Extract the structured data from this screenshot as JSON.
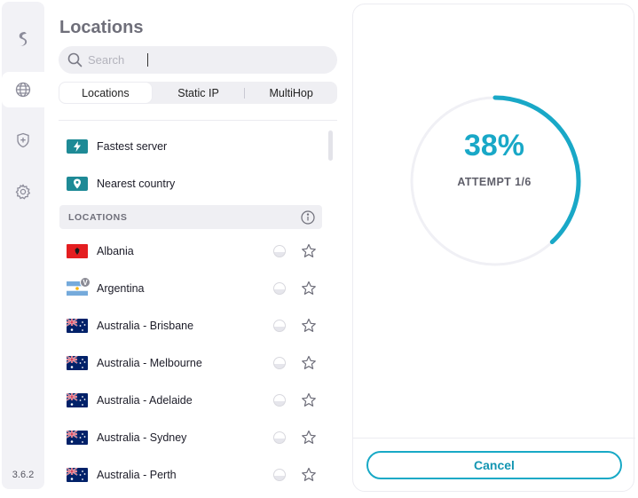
{
  "app": {
    "version": "3.6.2"
  },
  "nav": {
    "items": [
      {
        "icon": "surfshark-logo-icon"
      },
      {
        "icon": "globe-icon",
        "active": true
      },
      {
        "icon": "shield-plus-icon"
      },
      {
        "icon": "gear-icon"
      }
    ]
  },
  "locations_panel": {
    "title": "Locations",
    "search": {
      "placeholder": "Search",
      "value": ""
    },
    "tabs": [
      {
        "label": "Locations",
        "active": true
      },
      {
        "label": "Static IP",
        "active": false
      },
      {
        "label": "MultiHop",
        "active": false
      }
    ],
    "quick": [
      {
        "label": "Fastest server",
        "icon": "bolt-icon"
      },
      {
        "label": "Nearest country",
        "icon": "location-pin-icon"
      }
    ],
    "section_header": "LOCATIONS",
    "locations": [
      {
        "label": "Albania",
        "flag": "albania"
      },
      {
        "label": "Argentina",
        "flag": "argentina",
        "virtual_badge": "V"
      },
      {
        "label": "Australia - Brisbane",
        "flag": "australia"
      },
      {
        "label": "Australia - Melbourne",
        "flag": "australia"
      },
      {
        "label": "Australia - Adelaide",
        "flag": "australia"
      },
      {
        "label": "Australia - Sydney",
        "flag": "australia"
      },
      {
        "label": "Australia - Perth",
        "flag": "australia"
      }
    ]
  },
  "connection": {
    "percent_text": "38%",
    "progress": 0.38,
    "attempt_text": "ATTEMPT 1/6",
    "cancel_label": "Cancel",
    "colors": {
      "accent": "#19a8c7",
      "track": "#f0f0f5"
    }
  }
}
